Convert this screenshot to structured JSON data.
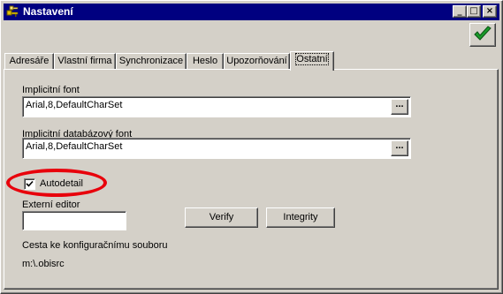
{
  "window": {
    "title": "Nastavení",
    "minimize_glyph": "_",
    "maximize_glyph": "□",
    "close_glyph": "×",
    "app_icon": "keys-icon",
    "ok_icon": "checkmark-icon",
    "accent_color": "#000080",
    "ok_color": "#1a9a2a"
  },
  "tabs": [
    {
      "label": "Adresáře",
      "active": false
    },
    {
      "label": "Vlastní firma",
      "active": false
    },
    {
      "label": "Synchronizace",
      "active": false
    },
    {
      "label": "Heslo",
      "active": false
    },
    {
      "label": "Upozorňování",
      "active": false
    },
    {
      "label": "Ostatní",
      "active": true
    }
  ],
  "settings": {
    "font_label": "Implicitní font",
    "font_value": "Arial,8,DefaultCharSet",
    "db_font_label": "Implicitní databázový font",
    "db_font_value": "Arial,8,DefaultCharSet",
    "ellipsis": "...",
    "autodetail_label": "Autodetail",
    "autodetail_checked": true,
    "external_editor_label": "Externí editor",
    "external_editor_value": "",
    "verify_label": "Verify",
    "integrity_label": "Integrity",
    "config_path_label": "Cesta ke konfiguračnímu souboru",
    "config_path_value": "m:\\.obisrc",
    "highlight_color": "#e8000b"
  }
}
